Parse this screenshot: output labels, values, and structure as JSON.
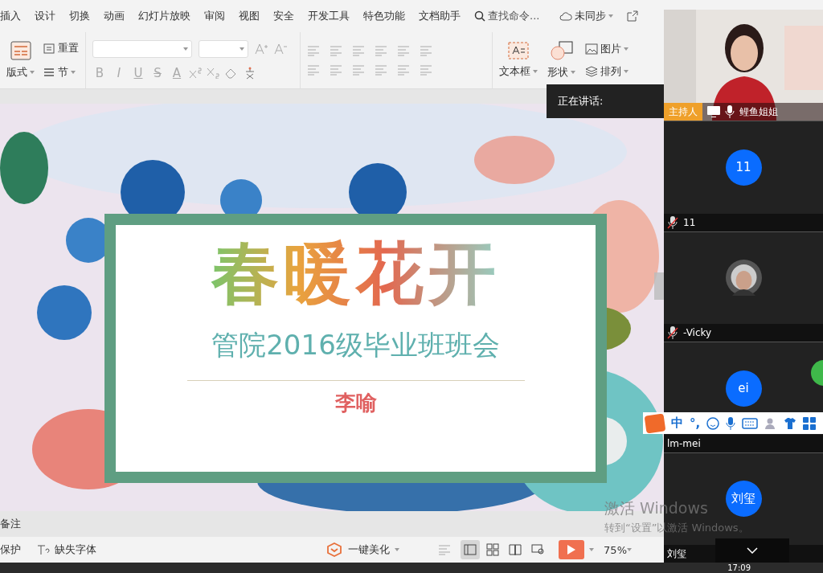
{
  "ribbon": {
    "tabs": [
      {
        "label": "插入",
        "selected": false
      },
      {
        "label": "设计",
        "selected": false
      },
      {
        "label": "切换",
        "selected": false
      },
      {
        "label": "动画",
        "selected": false
      },
      {
        "label": "幻灯片放映",
        "selected": false
      },
      {
        "label": "审阅",
        "selected": false
      },
      {
        "label": "视图",
        "selected": false
      },
      {
        "label": "安全",
        "selected": false
      },
      {
        "label": "开发工具",
        "selected": false
      },
      {
        "label": "特色功能",
        "selected": false
      },
      {
        "label": "文档助手",
        "selected": false
      }
    ],
    "search": {
      "placeholder": "查找命令..."
    },
    "sync": "未同步",
    "layout_button": "版式",
    "reset_button": "重置",
    "section_button": "节",
    "format_buttons": [
      "B",
      "I",
      "U",
      "S",
      "A"
    ],
    "insert_tools": [
      {
        "label": "文本框",
        "kind": "big"
      },
      {
        "label": "形状",
        "kind": "big"
      },
      {
        "label": "图片",
        "kind": "small"
      },
      {
        "label": "排列",
        "kind": "small"
      }
    ]
  },
  "slide": {
    "title": "春暖花开",
    "subtitle": "管院2016级毕业班班会",
    "author": "李喻"
  },
  "speaking_tooltip": "正在讲话:",
  "participants": [
    {
      "name": "鲤鱼姐姐",
      "kind": "video",
      "badge": "主持人",
      "muted": false
    },
    {
      "name": "11",
      "kind": "initials",
      "avatar": "11",
      "muted": true
    },
    {
      "name": "-Vicky",
      "muted": true
    },
    {
      "name": "lm-mei",
      "kind": "initials",
      "avatar": "ei"
    },
    {
      "name": "刘玺",
      "kind": "initials",
      "avatar": "刘玺"
    }
  ],
  "ime_toolbar": {
    "mode": "中",
    "punctuation": "°,"
  },
  "notes_label": "备注",
  "status_bar": {
    "left": [
      "保护",
      "缺失字体"
    ],
    "beautify": "一键美化",
    "views": [
      {
        "selected": true
      },
      {
        "selected": false
      },
      {
        "selected": false
      },
      {
        "selected": false
      }
    ],
    "zoom": "75%"
  },
  "activation": [
    "激活 Windows",
    "转到“设置”以激活 Windows。"
  ],
  "clock": "17:09"
}
